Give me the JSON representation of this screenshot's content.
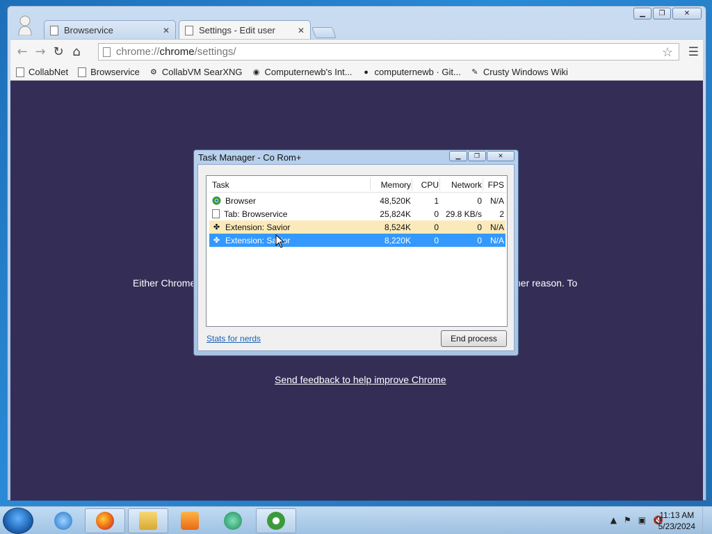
{
  "browser": {
    "tabs": [
      {
        "title": "Browservice",
        "active": false
      },
      {
        "title": "Settings - Edit user",
        "active": true
      }
    ],
    "address": {
      "scheme": "chrome://",
      "host": "chrome",
      "path": "/settings/"
    },
    "bookmarks": [
      {
        "label": "CollabNet",
        "icon": "page-icon"
      },
      {
        "label": "Browservice",
        "icon": "page-icon"
      },
      {
        "label": "CollabVM SearXNG",
        "icon": "searx-icon"
      },
      {
        "label": "Computernewb's Int...",
        "icon": "globe-icon"
      },
      {
        "label": "computernewb · Git...",
        "icon": "github-icon"
      },
      {
        "label": "Crusty Windows Wiki",
        "icon": "wiki-icon"
      }
    ]
  },
  "page": {
    "error_left": "Either Chrome",
    "error_right": "her reason.  To",
    "feedback_link": "Send feedback to help improve Chrome",
    "background": "#342e57"
  },
  "task_manager": {
    "title": "Task Manager - Co Rom+",
    "columns": {
      "task": "Task",
      "memory": "Memory",
      "cpu": "CPU",
      "network": "Network",
      "fps": "FPS"
    },
    "rows": [
      {
        "task": "Browser",
        "icon": "chrome-icon",
        "memory": "48,520K",
        "cpu": "1",
        "network": "0",
        "fps": "N/A"
      },
      {
        "task": "Tab: Browservice",
        "icon": "page-icon",
        "memory": "25,824K",
        "cpu": "0",
        "network": "29.8 KB/s",
        "fps": "2"
      },
      {
        "task": "Extension: Savior",
        "icon": "puzzle-icon",
        "memory": "8,524K",
        "cpu": "0",
        "network": "0",
        "fps": "N/A"
      },
      {
        "task": "Extension: Savior",
        "icon": "puzzle-icon",
        "memory": "8,220K",
        "cpu": "0",
        "network": "0",
        "fps": "N/A"
      }
    ],
    "stats_link": "Stats for nerds",
    "end_process": "End process"
  },
  "taskbar": {
    "clock_time": "11:13 AM",
    "clock_date": "5/23/2024"
  }
}
